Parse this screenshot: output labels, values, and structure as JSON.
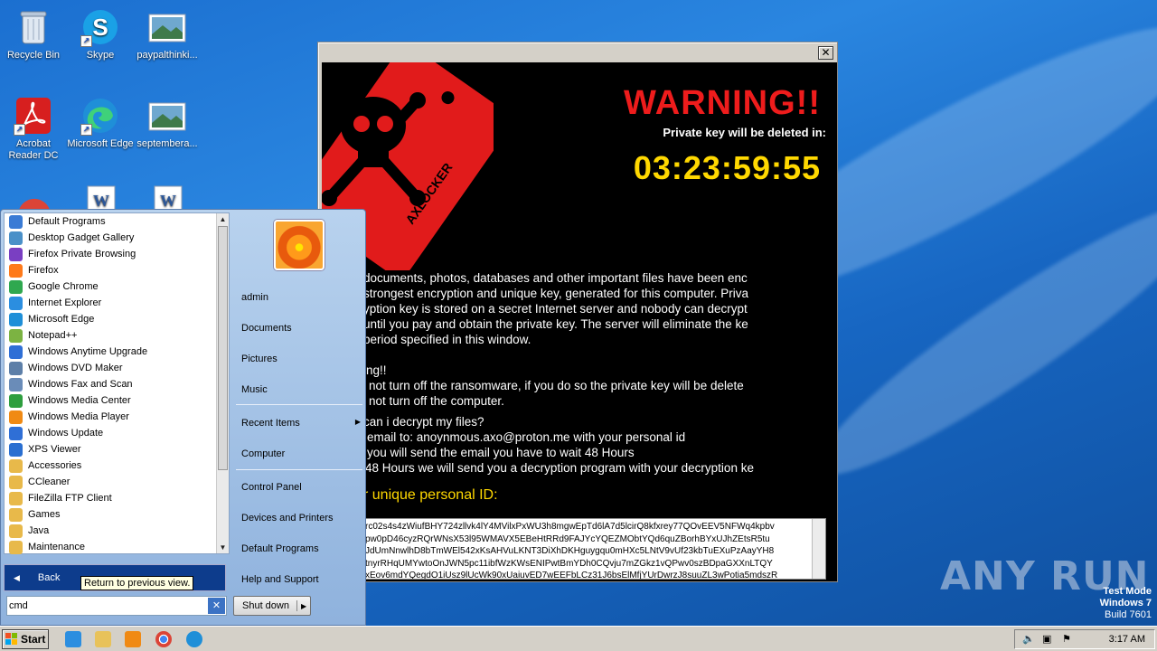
{
  "desktop": {
    "icons": [
      {
        "label": "Recycle Bin"
      },
      {
        "label": "Skype"
      },
      {
        "label": "paypalthinki..."
      },
      {
        "label": "Acrobat\nReader DC"
      },
      {
        "label": "Microsoft Edge"
      },
      {
        "label": "septembera..."
      }
    ],
    "watermark": {
      "line1": "Test Mode",
      "line2": "Windows 7",
      "line3": "Build 7601"
    },
    "anyrun_logo": "ANY RUN"
  },
  "ransom_window": {
    "close_label": "✕",
    "tag_text": "AXLOCKER",
    "warning": "WARNING!!",
    "private_key_notice": "Private key will be deleted in:",
    "timer": "03:23:59:55",
    "message_lines": [
      "documents, photos, databases and other important files have been enc",
      "strongest encryption and unique key, generated for this computer. Priva",
      "yption key is stored on a secret Internet server and nobody can decrypt",
      "until you pay and obtain the private key. The server will eliminate the ke",
      "period specified in this window."
    ],
    "warning_block": [
      "ing!!",
      "not turn off the ransomware,  if you do so the private key will be delete",
      "not turn off the computer."
    ],
    "howto_block": [
      "can i decrypt my files?",
      "email to: anoynmous.axo@proton.me with your personal id",
      "you will send the email you have to wait 48 Hours",
      "48 Hours we will send you a decryption program with your decryption ke"
    ],
    "uid_label": "r unique personal ID:",
    "uid_lines": [
      "rc02s4s4zWiufBHY724zllvk4lY4MVilxPxWU3h8mgwEpTd6lA7d5lcirQ8kfxrey77QOvEEV5NFWq4kpbv",
      "pw0pD46cyzRQrWNsX53l95WMAVX5EBeHtRRd9FAJYcYQEZMObtYQd6quZBorhBYxUJhZEtsR5tu",
      "JdUmNnwlhD8bTmWEl542xKsAHVuLKNT3DiXhDKHguygqu0mHXc5LNtV9vUf23kbTuEXuPzAayYH8",
      "tnyrRHqUMYwtoOnJWN5pc11ibfWzKWsENIPwtBmYDh0CQvju7mZGkz1vQPwv0szBDpaGXXnLTQY",
      "xEov6mdYQegdO1iUsz9lUcWk90xUaiuvED7wEEFbLCz31J6bsElMfjYUrDwrzJ8suuZL3wPotia5mdszR"
    ]
  },
  "start_menu": {
    "programs": [
      {
        "label": "Default Programs",
        "color": "#3a7bd5"
      },
      {
        "label": "Desktop Gadget Gallery",
        "color": "#4a90c8"
      },
      {
        "label": "Firefox Private Browsing",
        "color": "#7a3fc2"
      },
      {
        "label": "Firefox",
        "color": "#ff7a1a"
      },
      {
        "label": "Google Chrome",
        "color": "#2fa84f"
      },
      {
        "label": "Internet Explorer",
        "color": "#2b8ee0"
      },
      {
        "label": "Microsoft Edge",
        "color": "#1f8fd8"
      },
      {
        "label": "Notepad++",
        "color": "#7cb342"
      },
      {
        "label": "Windows Anytime Upgrade",
        "color": "#2f6fd6"
      },
      {
        "label": "Windows DVD Maker",
        "color": "#5d7fa8"
      },
      {
        "label": "Windows Fax and Scan",
        "color": "#6a8cb8"
      },
      {
        "label": "Windows Media Center",
        "color": "#2e9e3e"
      },
      {
        "label": "Windows Media Player",
        "color": "#f08a14"
      },
      {
        "label": "Windows Update",
        "color": "#2f6fd6"
      },
      {
        "label": "XPS Viewer",
        "color": "#2a6fd1"
      },
      {
        "label": "Accessories",
        "color": "#e8b94a"
      },
      {
        "label": "CCleaner",
        "color": "#e8b94a"
      },
      {
        "label": "FileZilla FTP Client",
        "color": "#e8b94a"
      },
      {
        "label": "Games",
        "color": "#e8b94a"
      },
      {
        "label": "Java",
        "color": "#e8b94a"
      },
      {
        "label": "Maintenance",
        "color": "#e8b94a"
      }
    ],
    "back_label": "Back",
    "tooltip": "Return to previous view.",
    "search_value": "cmd",
    "right_items": {
      "admin": "admin",
      "documents": "Documents",
      "pictures": "Pictures",
      "music": "Music",
      "recent": "Recent Items",
      "computer": "Computer",
      "control_panel": "Control Panel",
      "devices": "Devices and Printers",
      "default_programs": "Default Programs",
      "help": "Help and Support"
    },
    "shutdown_label": "Shut down"
  },
  "taskbar": {
    "start_label": "Start",
    "clock": "3:17 AM"
  }
}
